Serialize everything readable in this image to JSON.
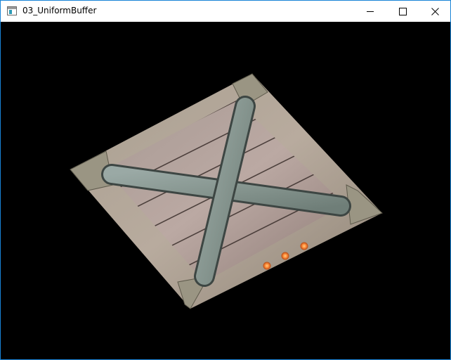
{
  "window": {
    "title": "03_UniformBuffer",
    "controls": {
      "minimize": "minimize",
      "maximize": "maximize",
      "close": "close"
    }
  },
  "scene": {
    "background": "#000000",
    "object": "wooden-crate-top",
    "lights": 3,
    "light_color": "#ff7a2a"
  }
}
